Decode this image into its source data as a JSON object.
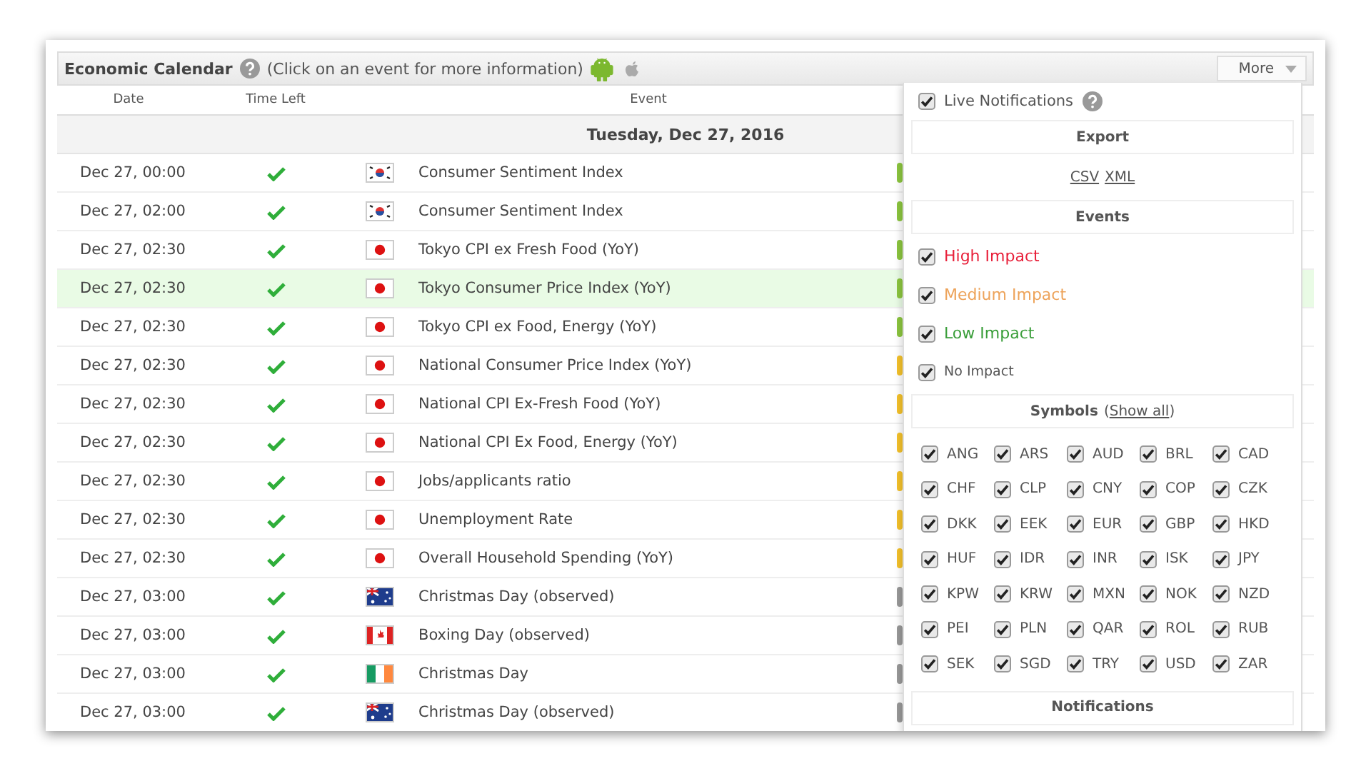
{
  "header": {
    "title": "Economic Calendar",
    "hint": "(Click on an event for more information)",
    "more_button": "More"
  },
  "columns": [
    "Date",
    "Time Left",
    "Event"
  ],
  "day_heading": "Tuesday, Dec 27, 2016",
  "rows": [
    {
      "date": "Dec 27, 00:00",
      "kind": "kr",
      "event": "Consumer Sentiment Index",
      "color": "#8cc63f",
      "selected": false
    },
    {
      "date": "Dec 27, 02:00",
      "kind": "kr",
      "event": "Consumer Sentiment Index",
      "color": "#8cc63f",
      "selected": false
    },
    {
      "date": "Dec 27, 02:30",
      "kind": "jp",
      "event": "Tokyo CPI ex Fresh Food (YoY)",
      "color": "#8cc63f",
      "selected": false
    },
    {
      "date": "Dec 27, 02:30",
      "kind": "jp",
      "event": "Tokyo Consumer Price Index (YoY)",
      "color": "#8cc63f",
      "selected": true
    },
    {
      "date": "Dec 27, 02:30",
      "kind": "jp",
      "event": "Tokyo CPI ex Food, Energy (YoY)",
      "color": "#8cc63f",
      "selected": false
    },
    {
      "date": "Dec 27, 02:30",
      "kind": "jp",
      "event": "National Consumer Price Index (YoY)",
      "color": "#f5c22b",
      "selected": false
    },
    {
      "date": "Dec 27, 02:30",
      "kind": "jp",
      "event": "National CPI Ex-Fresh Food (YoY)",
      "color": "#f5c22b",
      "selected": false
    },
    {
      "date": "Dec 27, 02:30",
      "kind": "jp",
      "event": "National CPI Ex Food, Energy (YoY)",
      "color": "#f5c22b",
      "selected": false
    },
    {
      "date": "Dec 27, 02:30",
      "kind": "jp",
      "event": "Jobs/applicants ratio",
      "color": "#f5c22b",
      "selected": false
    },
    {
      "date": "Dec 27, 02:30",
      "kind": "jp",
      "event": "Unemployment Rate",
      "color": "#f5c22b",
      "selected": false
    },
    {
      "date": "Dec 27, 02:30",
      "kind": "jp",
      "event": "Overall Household Spending (YoY)",
      "color": "#f5c22b",
      "selected": false
    },
    {
      "date": "Dec 27, 03:00",
      "kind": "au",
      "event": "Christmas Day (observed)",
      "color": "#999999",
      "selected": false
    },
    {
      "date": "Dec 27, 03:00",
      "kind": "ca",
      "event": "Boxing Day (observed)",
      "color": "#999999",
      "selected": false
    },
    {
      "date": "Dec 27, 03:00",
      "kind": "ie",
      "event": "Christmas Day",
      "color": "#999999",
      "selected": false
    },
    {
      "date": "Dec 27, 03:00",
      "kind": "au",
      "event": "Christmas Day (observed)",
      "color": "#999999",
      "selected": false
    }
  ],
  "panel": {
    "live_notifications": {
      "label": "Live Notifications",
      "checked": true
    },
    "export": {
      "heading": "Export",
      "links": [
        "CSV",
        "XML"
      ]
    },
    "events": {
      "heading": "Events",
      "items": [
        {
          "label": "High Impact",
          "color": "#e8203a",
          "checked": true
        },
        {
          "label": "Medium Impact",
          "color": "#eda35a",
          "checked": true
        },
        {
          "label": "Low Impact",
          "color": "#3a9e3a",
          "checked": true
        },
        {
          "label": "No Impact",
          "color": "#555555",
          "checked": true
        }
      ]
    },
    "symbols": {
      "heading": "Symbols",
      "open_paren": "(",
      "link": "Show all",
      "close_paren": ")",
      "items": [
        {
          "code": "ANG",
          "checked": true
        },
        {
          "code": "ARS",
          "checked": true
        },
        {
          "code": "AUD",
          "checked": true
        },
        {
          "code": "BRL",
          "checked": true
        },
        {
          "code": "CAD",
          "checked": true
        },
        {
          "code": "CHF",
          "checked": true
        },
        {
          "code": "CLP",
          "checked": true
        },
        {
          "code": "CNY",
          "checked": true
        },
        {
          "code": "COP",
          "checked": true
        },
        {
          "code": "CZK",
          "checked": true
        },
        {
          "code": "DKK",
          "checked": true
        },
        {
          "code": "EEK",
          "checked": true
        },
        {
          "code": "EUR",
          "checked": true
        },
        {
          "code": "GBP",
          "checked": true
        },
        {
          "code": "HKD",
          "checked": true
        },
        {
          "code": "HUF",
          "checked": true
        },
        {
          "code": "IDR",
          "checked": true
        },
        {
          "code": "INR",
          "checked": true
        },
        {
          "code": "ISK",
          "checked": true
        },
        {
          "code": "JPY",
          "checked": true
        },
        {
          "code": "KPW",
          "checked": true
        },
        {
          "code": "KRW",
          "checked": true
        },
        {
          "code": "MXN",
          "checked": true
        },
        {
          "code": "NOK",
          "checked": true
        },
        {
          "code": "NZD",
          "checked": true
        },
        {
          "code": "PEI",
          "checked": true
        },
        {
          "code": "PLN",
          "checked": true
        },
        {
          "code": "QAR",
          "checked": true
        },
        {
          "code": "ROL",
          "checked": true
        },
        {
          "code": "RUB",
          "checked": true
        },
        {
          "code": "SEK",
          "checked": true
        },
        {
          "code": "SGD",
          "checked": true
        },
        {
          "code": "TRY",
          "checked": true
        },
        {
          "code": "USD",
          "checked": true
        },
        {
          "code": "ZAR",
          "checked": true
        }
      ]
    },
    "notifications": {
      "heading": "Notifications"
    }
  }
}
